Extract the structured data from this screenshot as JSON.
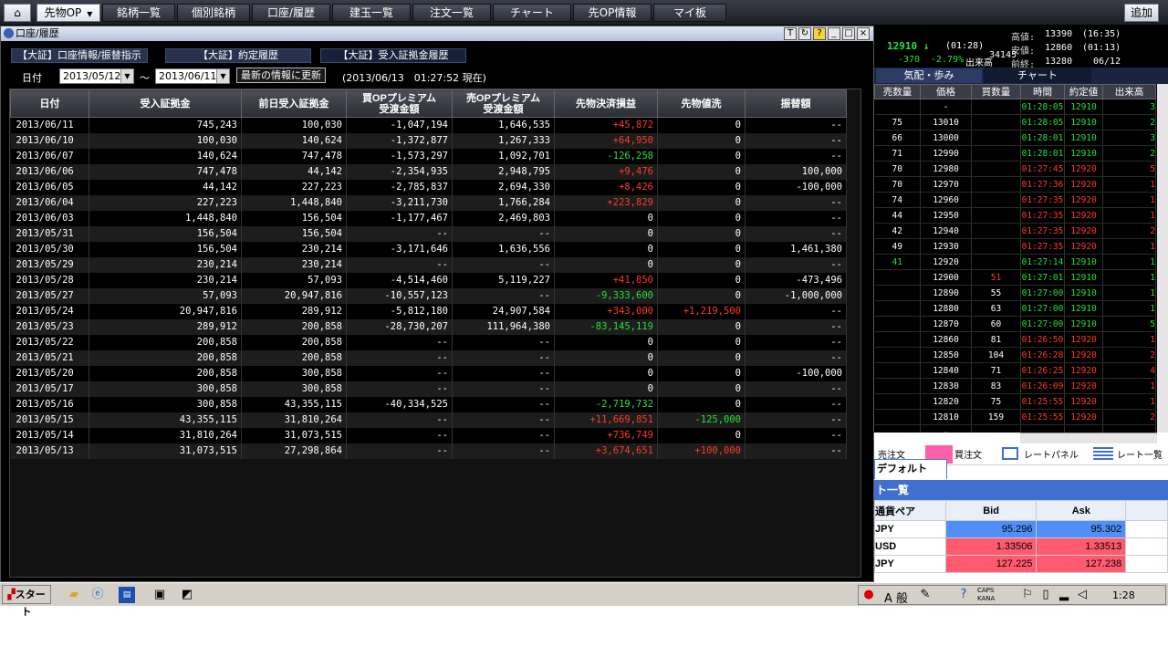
{
  "menu": {
    "home_icon": "home-icon",
    "items": [
      "先物OP",
      "銘柄一覧",
      "個別銘柄",
      "口座/履歴",
      "建玉一覧",
      "注文一覧",
      "チャート",
      "先OP情報",
      "マイ板"
    ],
    "add_label": "追加"
  },
  "account_window": {
    "title": "口座/履歴",
    "controls": [
      "T",
      "?",
      "_",
      "□",
      "×"
    ],
    "tabs": [
      "【大証】口座情報/振替指示",
      "【大証】約定履歴",
      "【大証】受入証拠金履歴"
    ],
    "date_label": "日付",
    "date_from": "2013/05/12",
    "date_sep": "～",
    "date_to": "2013/06/11",
    "refresh_label": "最新の情報に更新",
    "timestamp": "(2013/06/13　01:27:52 現在)",
    "columns": [
      "日付",
      "受入証拠金",
      "前日受入証拠金",
      "買OPプレミアム\n受渡金額",
      "売OPプレミアム\n受渡金額",
      "先物決済損益",
      "先物値洗",
      "振替額"
    ],
    "rows": [
      [
        "2013/06/11",
        "745,243",
        "100,030",
        "-1,047,194",
        "1,646,535",
        "+45,872",
        "0",
        "--"
      ],
      [
        "2013/06/10",
        "100,030",
        "140,624",
        "-1,372,877",
        "1,267,333",
        "+64,950",
        "0",
        "--"
      ],
      [
        "2013/06/07",
        "140,624",
        "747,478",
        "-1,573,297",
        "1,092,701",
        "-126,258",
        "0",
        "--"
      ],
      [
        "2013/06/06",
        "747,478",
        "44,142",
        "-2,354,935",
        "2,948,795",
        "+9,476",
        "0",
        "100,000"
      ],
      [
        "2013/06/05",
        "44,142",
        "227,223",
        "-2,785,837",
        "2,694,330",
        "+8,426",
        "0",
        "-100,000"
      ],
      [
        "2013/06/04",
        "227,223",
        "1,448,840",
        "-3,211,730",
        "1,766,284",
        "+223,829",
        "0",
        "--"
      ],
      [
        "2013/06/03",
        "1,448,840",
        "156,504",
        "-1,177,467",
        "2,469,803",
        "0",
        "0",
        "--"
      ],
      [
        "2013/05/31",
        "156,504",
        "156,504",
        "--",
        "--",
        "0",
        "0",
        "--"
      ],
      [
        "2013/05/30",
        "156,504",
        "230,214",
        "-3,171,646",
        "1,636,556",
        "0",
        "0",
        "1,461,380"
      ],
      [
        "2013/05/29",
        "230,214",
        "230,214",
        "--",
        "--",
        "0",
        "0",
        "--"
      ],
      [
        "2013/05/28",
        "230,214",
        "57,093",
        "-4,514,460",
        "5,119,227",
        "+41,850",
        "0",
        "-473,496"
      ],
      [
        "2013/05/27",
        "57,093",
        "20,947,816",
        "-10,557,123",
        "--",
        "-9,333,600",
        "0",
        "-1,000,000"
      ],
      [
        "2013/05/24",
        "20,947,816",
        "289,912",
        "-5,812,180",
        "24,907,584",
        "+343,000",
        "+1,219,500",
        "--"
      ],
      [
        "2013/05/23",
        "289,912",
        "200,858",
        "-28,730,207",
        "111,964,380",
        "-83,145,119",
        "0",
        "--"
      ],
      [
        "2013/05/22",
        "200,858",
        "200,858",
        "--",
        "--",
        "0",
        "0",
        "--"
      ],
      [
        "2013/05/21",
        "200,858",
        "200,858",
        "--",
        "--",
        "0",
        "0",
        "--"
      ],
      [
        "2013/05/20",
        "200,858",
        "300,858",
        "--",
        "--",
        "0",
        "0",
        "-100,000"
      ],
      [
        "2013/05/17",
        "300,858",
        "300,858",
        "--",
        "--",
        "0",
        "0",
        "--"
      ],
      [
        "2013/05/16",
        "300,858",
        "43,355,115",
        "-40,334,525",
        "--",
        "-2,719,732",
        "0",
        "--"
      ],
      [
        "2013/05/15",
        "43,355,115",
        "31,810,264",
        "--",
        "--",
        "+11,669,851",
        "-125,000",
        "--"
      ],
      [
        "2013/05/14",
        "31,810,264",
        "31,073,515",
        "--",
        "--",
        "+736,749",
        "0",
        "--"
      ],
      [
        "2013/05/13",
        "31,073,515",
        "27,298,864",
        "--",
        "--",
        "+3,674,651",
        "+100,000",
        "--"
      ]
    ]
  },
  "quote": {
    "high_label": "高値:",
    "high_value": "13390",
    "high_time": "(16:35)",
    "low_label": "安値:",
    "low_value": "12860",
    "low_time": "(01:13)",
    "prev_label": "前終:",
    "prev_value": "13280",
    "prev_date": "06/12",
    "last_price": "12910 ↓",
    "last_time": "(01:28)",
    "change": "-370",
    "change_pct": "-2.79%",
    "volume_label": "出来高",
    "volume": "34145"
  },
  "board_tabs": [
    "気配・歩み",
    "チャート"
  ],
  "board": {
    "columns": [
      "売数量",
      "価格",
      "買数量",
      "時間",
      "約定値",
      "出来高"
    ],
    "rows": [
      [
        "",
        "-",
        "",
        "01:28:05",
        "12910",
        "3"
      ],
      [
        "75",
        "13010",
        "",
        "01:28:05",
        "12910",
        "2"
      ],
      [
        "66",
        "13000",
        "",
        "01:28:01",
        "12910",
        "3"
      ],
      [
        "71",
        "12990",
        "",
        "01:28:01",
        "12910",
        "2"
      ],
      [
        "70",
        "12980",
        "",
        "01:27:45",
        "12920",
        "5"
      ],
      [
        "70",
        "12970",
        "",
        "01:27:36",
        "12920",
        "1"
      ],
      [
        "74",
        "12960",
        "",
        "01:27:35",
        "12920",
        "1"
      ],
      [
        "44",
        "12950",
        "",
        "01:27:35",
        "12920",
        "1"
      ],
      [
        "42",
        "12940",
        "",
        "01:27:35",
        "12920",
        "2"
      ],
      [
        "49",
        "12930",
        "",
        "01:27:35",
        "12920",
        "1"
      ],
      [
        "41",
        "12920",
        "",
        "01:27:14",
        "12910",
        "1"
      ],
      [
        "",
        "12900",
        "51",
        "01:27:01",
        "12910",
        "1"
      ],
      [
        "",
        "12890",
        "55",
        "01:27:00",
        "12910",
        "1"
      ],
      [
        "",
        "12880",
        "63",
        "01:27:00",
        "12910",
        "1"
      ],
      [
        "",
        "12870",
        "60",
        "01:27:00",
        "12910",
        "5"
      ],
      [
        "",
        "12860",
        "81",
        "01:26:50",
        "12920",
        "1"
      ],
      [
        "",
        "12850",
        "104",
        "01:26:28",
        "12920",
        "2"
      ],
      [
        "",
        "12840",
        "71",
        "01:26:25",
        "12920",
        "4"
      ],
      [
        "",
        "12830",
        "83",
        "01:26:09",
        "12920",
        "1"
      ],
      [
        "",
        "12820",
        "75",
        "01:25:55",
        "12920",
        "1"
      ],
      [
        "",
        "12810",
        "159",
        "01:25:55",
        "12920",
        "2"
      ],
      [
        "",
        "-",
        "",
        "",
        "",
        ""
      ]
    ]
  },
  "fx": {
    "tools": [
      "売注文",
      "買注文",
      "レートパネル",
      "レート一覧"
    ],
    "tab_label": "デフォルト",
    "bar_title": "ト一覧",
    "columns": [
      "通貨ペア",
      "Bid",
      "Ask"
    ],
    "rows": [
      [
        "JPY",
        "95.296",
        "95.302"
      ],
      [
        "USD",
        "1.33506",
        "1.33513"
      ],
      [
        "JPY",
        "127.225",
        "127.238"
      ]
    ],
    "bid_colors": [
      "#4f8ff7",
      "#ff5a6e",
      "#ff5a6e"
    ],
    "ask_colors": [
      "#4f8ff7",
      "#ff5a6e",
      "#ff5a6e"
    ]
  },
  "taskbar": {
    "start_label": "スタート",
    "ime_text": "A 般",
    "caps_label": "CAPS",
    "kana_label": "KANA",
    "clock": "1:28"
  }
}
